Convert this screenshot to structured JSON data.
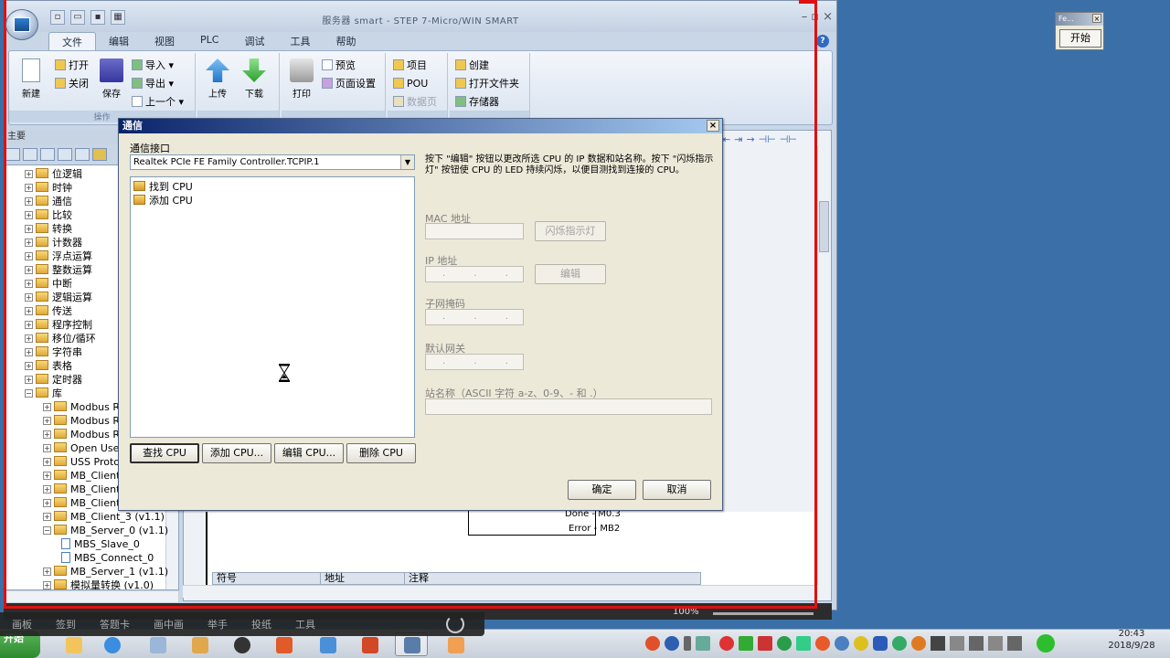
{
  "app": {
    "title": "服务器 smart - STEP 7-Micro/WIN SMART",
    "menu_tabs": [
      "文件",
      "编辑",
      "视图",
      "PLC",
      "调试",
      "工具",
      "帮助"
    ],
    "ribbon": {
      "new": "新建",
      "open": "打开",
      "close": "关闭",
      "save": "保存",
      "import": "导入",
      "export": "导出",
      "previous": "上一个",
      "upload": "上传",
      "download": "下载",
      "print": "打印",
      "preview": "预览",
      "page_setup": "页面设置",
      "project": "项目",
      "pou": "POU",
      "data_page": "数据页",
      "create": "创建",
      "open_folder": "打开文件夹",
      "memory": "存储器",
      "group_ops": "操作"
    },
    "tree_header": "主要",
    "tree_items": [
      {
        "label": "位逻辑",
        "type": "folder",
        "indent": 0
      },
      {
        "label": "时钟",
        "type": "folder",
        "indent": 0
      },
      {
        "label": "通信",
        "type": "folder",
        "indent": 0
      },
      {
        "label": "比较",
        "type": "folder",
        "indent": 0
      },
      {
        "label": "转换",
        "type": "folder",
        "indent": 0
      },
      {
        "label": "计数器",
        "type": "folder",
        "indent": 0
      },
      {
        "label": "浮点运算",
        "type": "folder",
        "indent": 0
      },
      {
        "label": "整数运算",
        "type": "folder",
        "indent": 0
      },
      {
        "label": "中断",
        "type": "folder",
        "indent": 0
      },
      {
        "label": "逻辑运算",
        "type": "folder",
        "indent": 0
      },
      {
        "label": "传送",
        "type": "folder",
        "indent": 0
      },
      {
        "label": "程序控制",
        "type": "folder",
        "indent": 0
      },
      {
        "label": "移位/循环",
        "type": "folder",
        "indent": 0
      },
      {
        "label": "字符串",
        "type": "folder",
        "indent": 0
      },
      {
        "label": "表格",
        "type": "folder",
        "indent": 0
      },
      {
        "label": "定时器",
        "type": "folder",
        "indent": 0
      },
      {
        "label": "库",
        "type": "folder",
        "indent": 0
      },
      {
        "label": "Modbus RT",
        "type": "folder",
        "indent": 1
      },
      {
        "label": "Modbus RT",
        "type": "folder",
        "indent": 1
      },
      {
        "label": "Modbus RT",
        "type": "folder",
        "indent": 1
      },
      {
        "label": "Open User",
        "type": "folder",
        "indent": 1
      },
      {
        "label": "USS Proto",
        "type": "folder",
        "indent": 1
      },
      {
        "label": "MB_Client_",
        "type": "folder",
        "indent": 1
      },
      {
        "label": "MB_Client_",
        "type": "folder",
        "indent": 1
      },
      {
        "label": "MB_Client_",
        "type": "folder",
        "indent": 1
      },
      {
        "label": "MB_Client_3 (v1.1)",
        "type": "folder",
        "indent": 1
      },
      {
        "label": "MB_Server_0 (v1.1)",
        "type": "folder",
        "indent": 1
      },
      {
        "label": "MBS_Slave_0",
        "type": "doc",
        "indent": 2
      },
      {
        "label": "MBS_Connect_0",
        "type": "doc",
        "indent": 2
      },
      {
        "label": "MB_Server_1 (v1.1)",
        "type": "folder",
        "indent": 1
      },
      {
        "label": "模拟量转换 (v1.0)",
        "type": "folder",
        "indent": 1
      }
    ],
    "editor": {
      "done_label": "Done",
      "done_value": "M0.3",
      "error_label": "Error",
      "error_value": "MB2",
      "table_cols": [
        "符号",
        "地址",
        "注释"
      ]
    },
    "zoom": "100%"
  },
  "dialog": {
    "title": "通信",
    "interface_label": "通信接口",
    "interface_value": "Realtek PCIe FE Family Controller.TCPIP.1",
    "list_items": [
      "找到 CPU",
      "添加 CPU"
    ],
    "description": "按下 \"编辑\" 按钮以更改所选 CPU 的 IP 数据和站名称。按下 \"闪烁指示灯\" 按钮使 CPU 的 LED 持续闪烁，以便目测找到连接的 CPU。",
    "mac_label": "MAC 地址",
    "flash_button": "闪烁指示灯",
    "ip_label": "IP 地址",
    "edit_button": "编辑",
    "subnet_label": "子网掩码",
    "gateway_label": "默认网关",
    "station_label": "站名称（ASCII 字符 a-z、0-9、- 和 .）",
    "ip_placeholder": ". . .",
    "buttons": {
      "find": "查找 CPU",
      "add": "添加 CPU...",
      "edit": "编辑 CPU...",
      "delete": "删除 CPU",
      "ok": "确定",
      "cancel": "取消"
    }
  },
  "mini_window": {
    "title": "Fe...",
    "button": "开始"
  },
  "overlay_bar": {
    "items": [
      "画板",
      "签到",
      "答题卡",
      "画中画",
      "举手",
      "投纸",
      "工具"
    ]
  },
  "taskbar": {
    "start": "开始",
    "time": "20:43",
    "date": "2018/9/28"
  }
}
